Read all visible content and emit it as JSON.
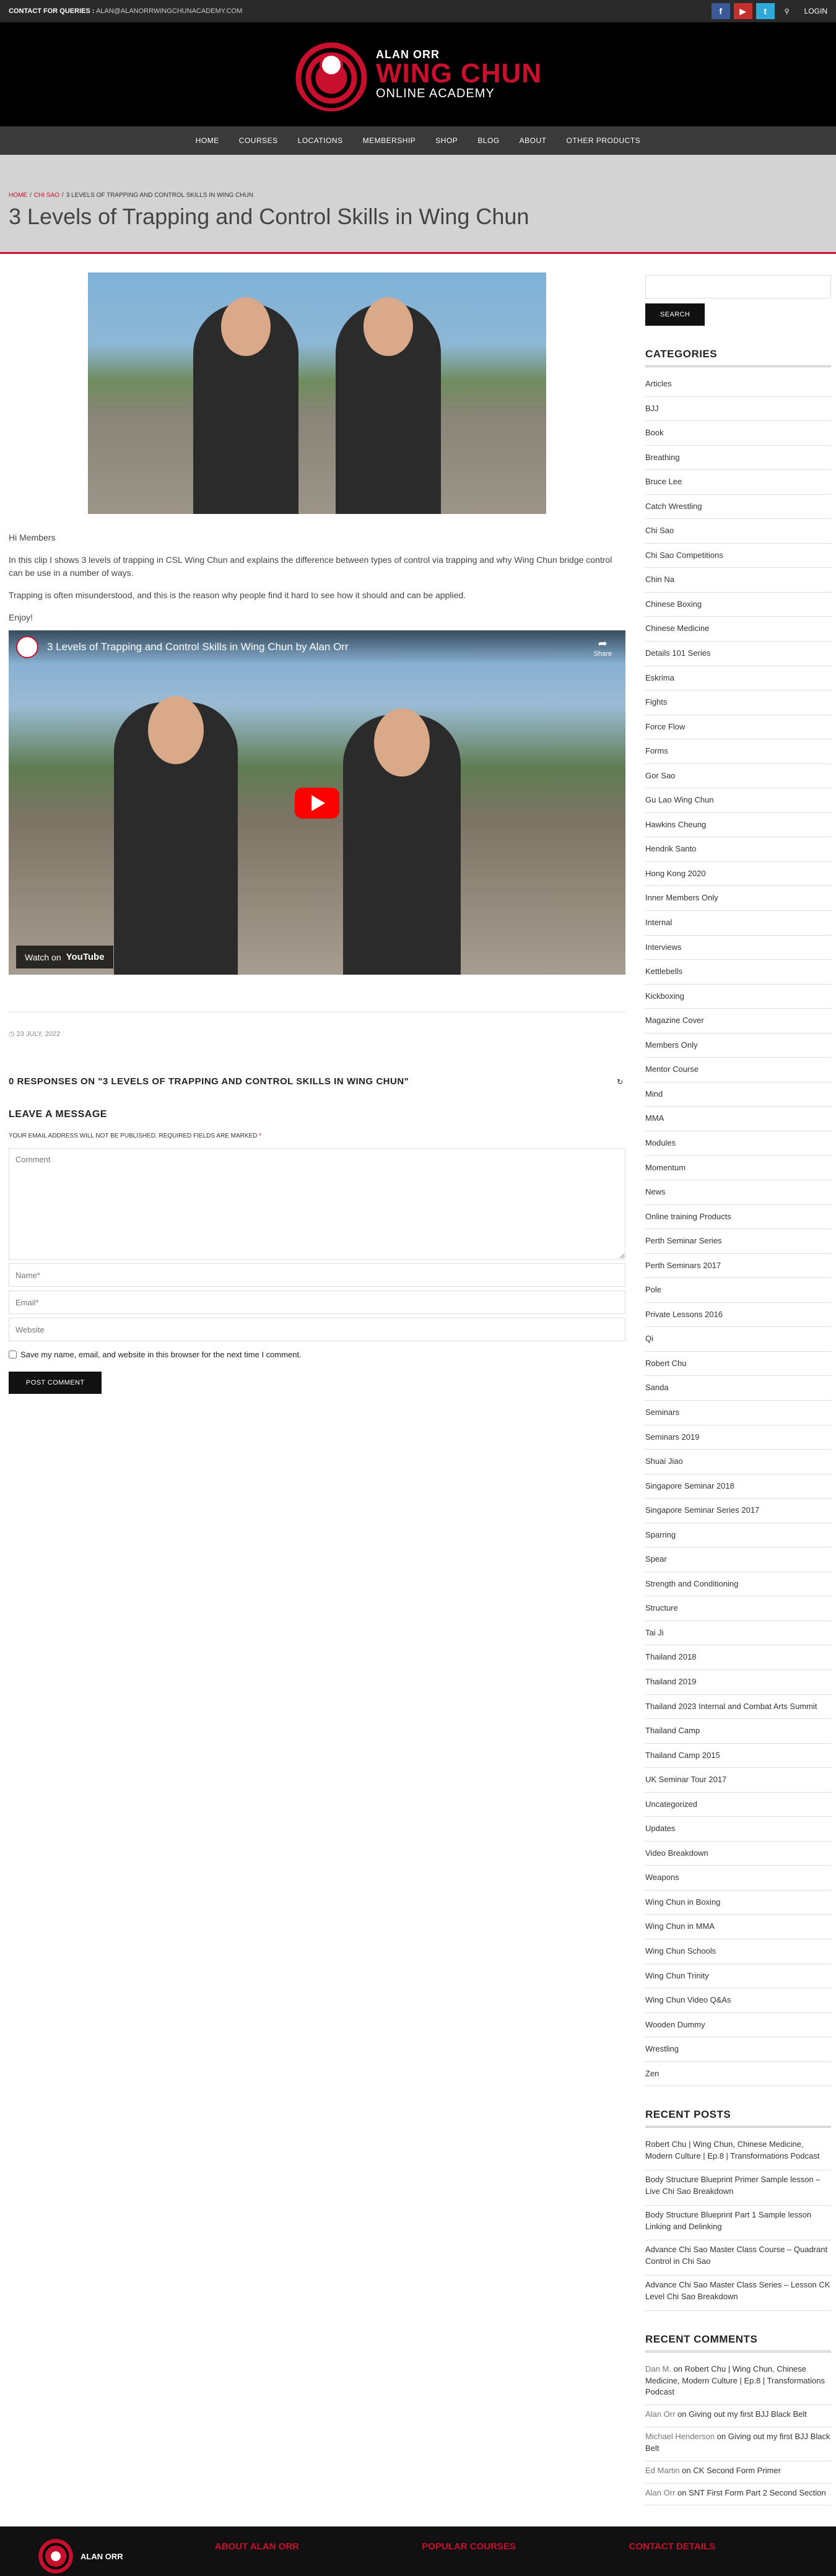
{
  "topbar": {
    "contact_label": "CONTACT FOR QUERIES :",
    "contact_email": "ALAN@ALANORRWINGCHUNACADEMY.COM",
    "login": "LOGIN",
    "icons": [
      "facebook-icon",
      "youtube-icon",
      "twitter-icon",
      "search-icon"
    ]
  },
  "logo": {
    "line1": "ALAN ORR",
    "line2": "WING CHUN",
    "line3": "ONLINE ACADEMY"
  },
  "nav": [
    "HOME",
    "COURSES",
    "LOCATIONS",
    "MEMBERSHIP",
    "SHOP",
    "BLOG",
    "ABOUT",
    "OTHER PRODUCTS"
  ],
  "breadcrumb": {
    "home": "HOME",
    "category": "CHI SAO",
    "current": "3 LEVELS OF TRAPPING AND CONTROL SKILLS IN WING CHUN"
  },
  "page_title": "3 Levels of Trapping and Control Skills in Wing Chun",
  "content": {
    "greeting": "Hi Members",
    "p1": "In this clip I shows 3 levels of trapping in CSL Wing Chun and explains the difference between types of control via trapping and why Wing Chun bridge control can be use in a number of ways.",
    "p2": "Trapping is often misunderstood, and this is the reason why people find it hard to see how it should and can be applied.",
    "p3": "Enjoy!"
  },
  "video": {
    "title": "3 Levels of Trapping and Control Skills in Wing Chun by Alan Orr",
    "share": "Share",
    "watch_on": "Watch on",
    "youtube": "YouTube"
  },
  "post_date": "23 JULY, 2022",
  "comments": {
    "responses_heading": "0 RESPONSES ON \"3 LEVELS OF TRAPPING AND CONTROL SKILLS IN WING CHUN\"",
    "leave_heading": "LEAVE A MESSAGE",
    "note": "YOUR EMAIL ADDRESS WILL NOT BE PUBLISHED. REQUIRED FIELDS ARE MARKED",
    "required_mark": "*",
    "comment_placeholder": "Comment",
    "name_placeholder": "Name*",
    "email_placeholder": "Email*",
    "website_placeholder": "Website",
    "save_label": "Save my name, email, and website in this browser for the next time I comment.",
    "submit": "POST COMMENT"
  },
  "sidebar": {
    "search_button": "SEARCH",
    "categories_title": "CATEGORIES",
    "categories": [
      "Articles",
      "BJJ",
      "Book",
      "Breathing",
      "Bruce Lee",
      "Catch Wrestling",
      "Chi Sao",
      "Chi Sao Competitions",
      "Chin Na",
      "Chinese Boxing",
      "Chinese Medicine",
      "Details 101 Series",
      "Eskrima",
      "Fights",
      "Force Flow",
      "Forms",
      "Gor Sao",
      "Gu Lao Wing Chun",
      "Hawkins Cheung",
      "Hendrik Santo",
      "Hong Kong 2020",
      "Inner Members Only",
      "Internal",
      "Interviews",
      "Kettlebells",
      "Kickboxing",
      "Magazine Cover",
      "Members Only",
      "Mentor Course",
      "Mind",
      "MMA",
      "Modules",
      "Momentum",
      "News",
      "Online training Products",
      "Perth Seminar Series",
      "Perth Seminars 2017",
      "Pole",
      "Private Lessons 2016",
      "Qi",
      "Robert Chu",
      "Sanda",
      "Seminars",
      "Seminars 2019",
      "Shuai Jiao",
      "Singapore Seminar 2018",
      "Singapore Seminar Series 2017",
      "Sparring",
      "Spear",
      "Strength and Conditioning",
      "Structure",
      "Tai Ji",
      "Thailand 2018",
      "Thailand 2019",
      "Thailand 2023 Internal and Combat Arts Summit",
      "Thailand Camp",
      "Thailand Camp 2015",
      "UK Seminar Tour 2017",
      "Uncategorized",
      "Updates",
      "Video Breakdown",
      "Weapons",
      "Wing Chun in Boxing",
      "Wing Chun in MMA",
      "Wing Chun Schools",
      "Wing Chun Trinity",
      "Wing Chun Video Q&As",
      "Wooden Dummy",
      "Wrestling",
      "Zen"
    ],
    "recent_posts_title": "RECENT POSTS",
    "recent_posts": [
      "Robert Chu | Wing Chun, Chinese Medicine, Modern Culture | Ep.8 | Transformations Podcast",
      "Body Structure Blueprint Primer Sample lesson – Live Chi Sao Breakdown",
      "Body Structure Blueprint Part 1 Sample lesson Linking and Delinking",
      "Advance Chi Sao Master Class Course – Quadrant Control in Chi Sao",
      "Advance Chi Sao Master Class Series – Lesson CK Level Chi Sao Breakdown"
    ],
    "recent_comments_title": "RECENT COMMENTS",
    "recent_comments": [
      {
        "author": "Dan M.",
        "on": "on",
        "post": "Robert Chu | Wing Chun, Chinese Medicine, Modern Culture | Ep.8 | Transformations Podcast"
      },
      {
        "author": "Alan Orr",
        "on": "on",
        "post": "Giving out my first BJJ Black Belt"
      },
      {
        "author": "Michael Henderson",
        "on": "on",
        "post": "Giving out my first BJJ Black Belt"
      },
      {
        "author": "Ed Martin",
        "on": "on",
        "post": "CK Second Form Primer"
      },
      {
        "author": "Alan Orr",
        "on": "on",
        "post": "SNT First Form Part 2 Second Section"
      }
    ]
  },
  "footer": {
    "logo_text": "ALAN ORR",
    "col1": "ABOUT ALAN ORR",
    "col2": "POPULAR COURSES",
    "col3": "CONTACT DETAILS"
  },
  "colors": {
    "accent": "#c8102e",
    "topbar": "#2a2a2a",
    "nav": "#3a3a3a",
    "title_band": "#d3d3d3"
  }
}
